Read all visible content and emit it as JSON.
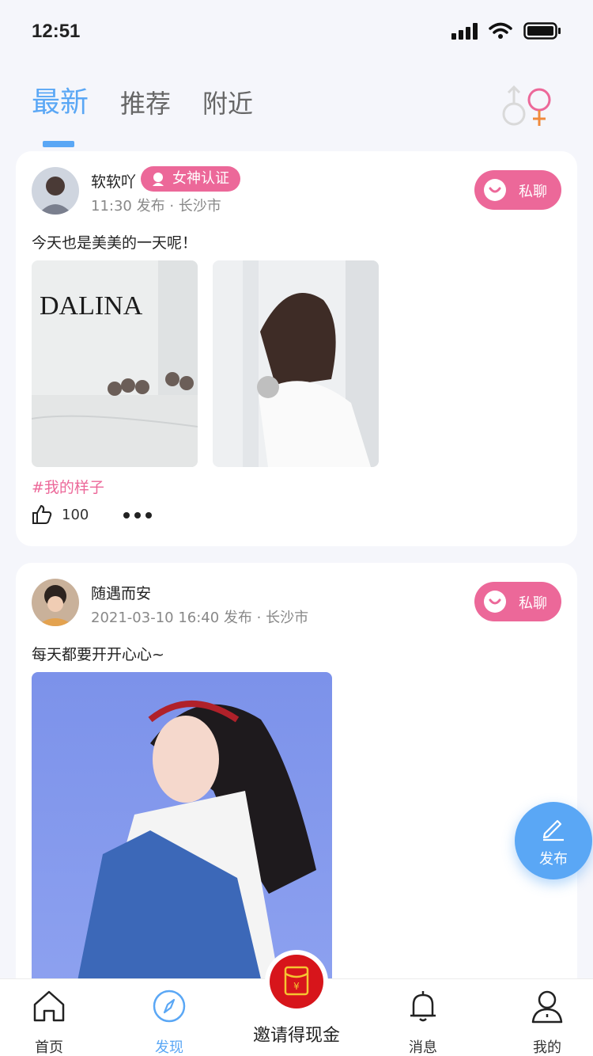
{
  "status_bar": {
    "time": "12:51"
  },
  "top_tabs": [
    {
      "label": "最新",
      "active": true
    },
    {
      "label": "推荐",
      "active": false
    },
    {
      "label": "附近",
      "active": false
    }
  ],
  "posts": [
    {
      "username": "软软吖",
      "badge": "女神认证",
      "meta": "11:30 发布 · 长沙市",
      "chat_label": "私聊",
      "text": "今天也是美美的一天呢！",
      "photo_caption": "DALINA",
      "hashtag": "#我的样子",
      "likes": "100"
    },
    {
      "username": "随遇而安",
      "meta": "2021-03-10 16:40 发布 · 长沙市",
      "chat_label": "私聊",
      "text": "每天都要开开心心~"
    }
  ],
  "fab": {
    "label": "发布"
  },
  "tabbar": {
    "items": [
      {
        "label": "首页"
      },
      {
        "label": "发现"
      },
      {
        "label": "消息"
      },
      {
        "label": "我的"
      }
    ],
    "invite_label": "邀请得现金"
  },
  "colors": {
    "accent": "#5aa7f5",
    "pink": "#ec6899",
    "red": "#d7151b"
  }
}
